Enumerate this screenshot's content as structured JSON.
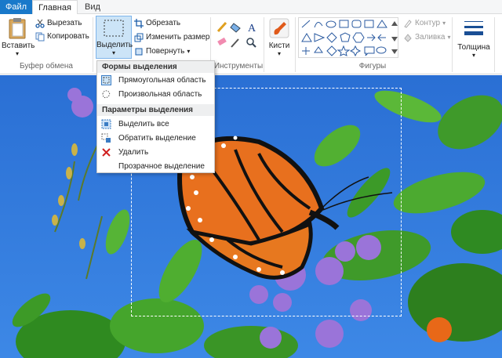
{
  "tabs": {
    "file": "Файл",
    "home": "Главная",
    "view": "Вид"
  },
  "clipboard": {
    "paste": "Вставить",
    "cut": "Вырезать",
    "copy": "Копировать",
    "group": "Буфер обмена"
  },
  "image": {
    "select": "Выделить",
    "crop": "Обрезать",
    "resize": "Изменить размер",
    "rotate": "Повернуть"
  },
  "tools": {
    "group": "Инструменты"
  },
  "brushes": {
    "label": "Кисти"
  },
  "shapes": {
    "group": "Фигуры",
    "outline": "Контур",
    "fill": "Заливка"
  },
  "size": {
    "label": "Толщина"
  },
  "menu": {
    "header1": "Формы выделения",
    "rect": "Прямоугольная область",
    "free": "Произвольная область",
    "header2": "Параметры выделения",
    "select_all": "Выделить все",
    "invert": "Обратить выделение",
    "delete": "Удалить",
    "transparent": "Прозрачное выделение"
  },
  "colors": {
    "file_tab": "#1979ca",
    "sky": "#2f73d6",
    "leaf": "#3f9a2a",
    "wing": "#e8701e",
    "flower": "#9a74d9"
  }
}
